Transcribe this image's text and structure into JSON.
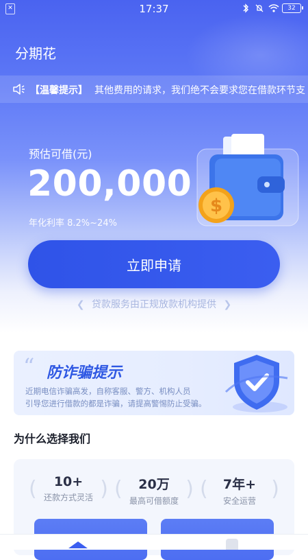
{
  "status_bar": {
    "time": "17:37",
    "battery": "32",
    "icons": [
      "bluetooth-icon",
      "mute-icon",
      "wifi-icon",
      "battery-icon"
    ]
  },
  "app": {
    "title": "分期花"
  },
  "notice": {
    "label": "【温馨提示】",
    "message": "其他费用的请求，我们绝不会要求您在借款环节支"
  },
  "loan": {
    "estimate_label": "预估可借(元)",
    "amount": "200,000",
    "rate": "年化利率 8.2%~24%"
  },
  "apply": {
    "button_label": "立即申请"
  },
  "provider_note": "贷款服务由正规放款机构提供",
  "fraud": {
    "title": "防诈骗提示",
    "line1": "近期电信诈骗高发，自称客服、警方、机构人员",
    "line2": "引导您进行借款的都是诈骗，请提高警惕防止受骗。"
  },
  "why": {
    "title": "为什么选择我们",
    "stats": [
      {
        "value": "10+",
        "label": "还款方式灵活"
      },
      {
        "value": "20万",
        "label": "最高可借额度"
      },
      {
        "value": "7年+",
        "label": "安全运营"
      }
    ]
  },
  "colors": {
    "primary": "#3b5ef0",
    "hero_top": "#4a63f0",
    "coin": "#f6a623",
    "fraud_title": "#2f58e3"
  }
}
